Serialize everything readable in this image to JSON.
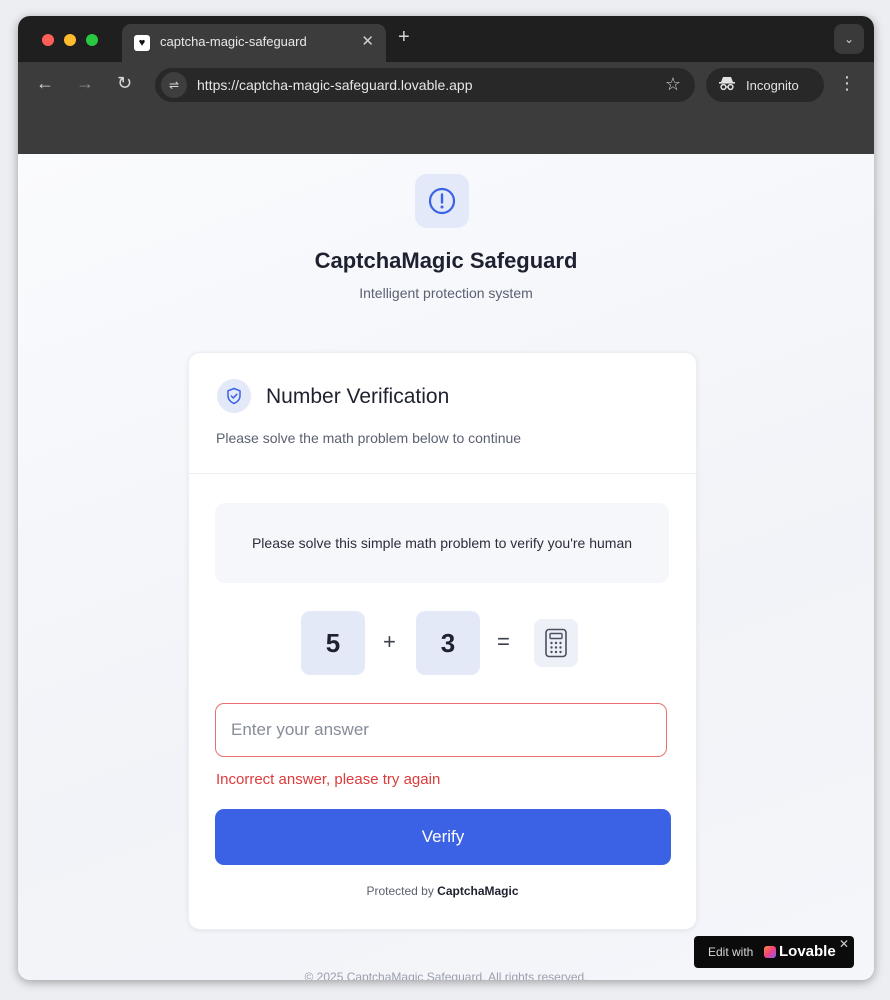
{
  "browser": {
    "tab": {
      "title": "captcha-magic-safeguard",
      "favicon_icon": "heart-icon",
      "close_glyph": "✕"
    },
    "new_tab_glyph": "+",
    "tab_menu_glyph": "⌄",
    "nav": {
      "back_glyph": "←",
      "forward_glyph": "→",
      "reload_glyph": "↻"
    },
    "site_info_glyph": "⇌",
    "url": "https://captcha-magic-safeguard.lovable.app",
    "bookmark_glyph": "☆",
    "incognito": {
      "label": "Incognito",
      "icon": "incognito-icon"
    },
    "menu_glyph": "⋮"
  },
  "app": {
    "title": "CaptchaMagic Safeguard",
    "subtitle": "Intelligent protection system",
    "logo_icon": "alert-circle-icon"
  },
  "card": {
    "title": "Number Verification",
    "description": "Please solve the math problem below to continue",
    "title_icon": "shield-check-icon",
    "prompt": "Please solve this simple math problem to verify you're human",
    "equation": {
      "operand_a": "5",
      "operator": "+",
      "operand_b": "3",
      "equals": "=",
      "result_icon": "calculator-icon"
    },
    "answer": {
      "value": "",
      "placeholder": "Enter your answer"
    },
    "error": "Incorrect answer, please try again",
    "verify_label": "Verify",
    "protected_prefix": "Protected by",
    "protected_brand": "CaptchaMagic"
  },
  "footer": {
    "text": "© 2025 CaptchaMagic Safeguard. All rights reserved."
  },
  "lovable_badge": {
    "edit_label": "Edit with",
    "brand": "Lovable",
    "close_glyph": "✕"
  },
  "colors": {
    "accent": "#3b62e4",
    "error": "#dc3b3b",
    "tile": "#e4e9f7",
    "chrome_dark": "#1f1f1f"
  }
}
